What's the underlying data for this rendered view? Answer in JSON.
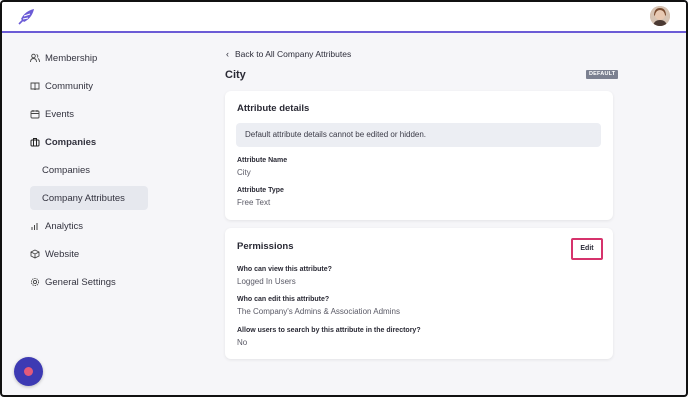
{
  "sidebar": {
    "items": [
      {
        "label": "Membership",
        "icon": "users-icon"
      },
      {
        "label": "Community",
        "icon": "book-icon"
      },
      {
        "label": "Events",
        "icon": "calendar-icon"
      },
      {
        "label": "Companies",
        "icon": "briefcase-icon"
      },
      {
        "label": "Companies",
        "icon": ""
      },
      {
        "label": "Company Attributes",
        "icon": ""
      },
      {
        "label": "Analytics",
        "icon": "bar-chart-icon"
      },
      {
        "label": "Website",
        "icon": "cube-icon"
      },
      {
        "label": "General Settings",
        "icon": "gear-icon"
      }
    ],
    "active": "Company Attributes"
  },
  "main": {
    "back_link": "Back to All Company Attributes",
    "title": "City",
    "badge": "DEFAULT",
    "details": {
      "title": "Attribute details",
      "notice": "Default attribute details cannot be edited or hidden.",
      "name_label": "Attribute Name",
      "name_value": "City",
      "type_label": "Attribute Type",
      "type_value": "Free Text"
    },
    "permissions": {
      "title": "Permissions",
      "edit_label": "Edit",
      "view_label": "Who can view this attribute?",
      "view_value": "Logged In Users",
      "edit_q_label": "Who can edit this attribute?",
      "edit_q_value": "The Company's Admins & Association Admins",
      "search_label": "Allow users to search by this attribute in the directory?",
      "search_value": "No"
    }
  },
  "colors": {
    "accent": "#6b5bd6",
    "highlight": "#d6336c",
    "fab": "#3d3ab3"
  }
}
